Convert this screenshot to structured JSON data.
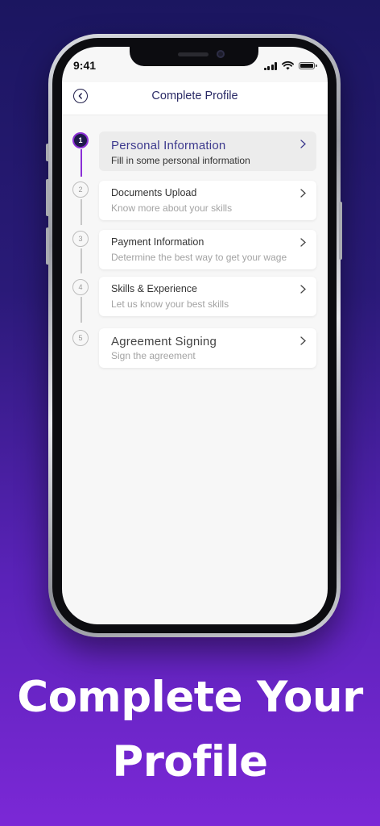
{
  "status_bar": {
    "time": "9:41",
    "icons": [
      "signal-icon",
      "wifi-icon",
      "battery-icon"
    ]
  },
  "header": {
    "title": "Complete Profile",
    "back_icon": "back-circle-icon"
  },
  "steps": [
    {
      "number": "1",
      "title": "Personal Information",
      "subtitle": "Fill in some personal information",
      "active": true
    },
    {
      "number": "2",
      "title": "Documents Upload",
      "subtitle": "Know more about your skills",
      "active": false
    },
    {
      "number": "3",
      "title": "Payment Information",
      "subtitle": "Determine the best way to get your wage",
      "active": false
    },
    {
      "number": "4",
      "title": "Skills & Experience",
      "subtitle": "Let us know your best skills",
      "active": false
    },
    {
      "number": "5",
      "title": "Agreement Signing",
      "subtitle": "Sign the agreement",
      "active": false
    }
  ],
  "caption": {
    "line1": "Complete Your",
    "line2": "Profile"
  },
  "colors": {
    "accent": "#8b2fd6",
    "active_step_fill": "#1e1a4a",
    "title_text": "#2a2a66",
    "background_top": "#1b1660",
    "background_bottom": "#7b28d6"
  }
}
